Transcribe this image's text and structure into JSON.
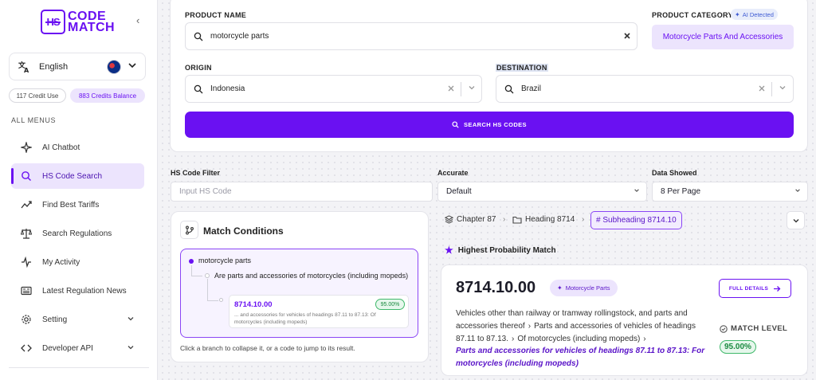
{
  "brand": {
    "logo_mark": "HS",
    "line1": "CODE",
    "line2": "MATCH",
    "accent": "#6a11f2"
  },
  "sidebar": {
    "collapse_glyph": "‹",
    "language": "English",
    "credit_used": "117 Credit Use",
    "credits_balance": "883 Credits Balance",
    "menu_heading": "ALL MENUS",
    "items": [
      {
        "label": "AI Chatbot",
        "icon": "sparkles-icon"
      },
      {
        "label": "HS Code Search",
        "icon": "search-icon",
        "active": true
      },
      {
        "label": "Find Best Tariffs",
        "icon": "trend-icon"
      },
      {
        "label": "Search Regulations",
        "icon": "scale-icon"
      },
      {
        "label": "My Activity",
        "icon": "activity-icon"
      },
      {
        "label": "Latest Regulation News",
        "icon": "newspaper-icon"
      },
      {
        "label": "Setting",
        "icon": "gear-icon",
        "expandable": true
      },
      {
        "label": "Developer API",
        "icon": "code-icon",
        "expandable": true
      }
    ]
  },
  "form": {
    "product_name_label": "PRODUCT NAME",
    "product_name_value": "motorcycle parts",
    "product_category_label": "PRODUCT CATEGORY",
    "ai_detected": "AI Detected",
    "category_value": "Motorcycle Parts And Accessories",
    "origin_label": "ORIGIN",
    "origin_value": "Indonesia",
    "destination_label": "DESTINATION",
    "destination_value": "Brazil",
    "search_button": "SEARCH HS CODES"
  },
  "filters": {
    "hs_filter_label": "HS Code Filter",
    "hs_filter_placeholder": "Input HS Code",
    "accurate_label": "Accurate",
    "accurate_value": "Default",
    "data_showed_label": "Data Showed",
    "data_showed_value": "8 Per Page"
  },
  "match_conditions": {
    "title": "Match Conditions",
    "root": "motorcycle parts",
    "branch": "Are parts and accessories of motorcycles (including mopeds)",
    "code": "8714.10.00",
    "code_match": "95.00%",
    "code_desc": "... and accessories for vehicles of headings 87.11 to 87.13: Of motorcycles (including mopeds)",
    "hint": "Click a branch to collapse it, or a code to jump to its result."
  },
  "breadcrumb": {
    "chapter": "Chapter 87",
    "heading": "Heading 8714",
    "subheading": "# Subheading 8714.10"
  },
  "result": {
    "section_title": "Highest Probability Match",
    "code": "8714.10.00",
    "badge": "Motorcycle Parts",
    "full_details": "FULL DETAILS",
    "desc_1": "Vehicles other than railway or tramway rollingstock, and parts and accessories thereof",
    "desc_2": "Parts and accessories of vehicles of headings 87.11 to 87.13.",
    "desc_3": "Of motorcycles (including mopeds)",
    "desc_final": "Parts and accessories for vehicles of headings 87.11 to 87.13: For motorcycles (including mopeds)",
    "match_level_label": "MATCH LEVEL",
    "match_level_value": "95.00%"
  }
}
